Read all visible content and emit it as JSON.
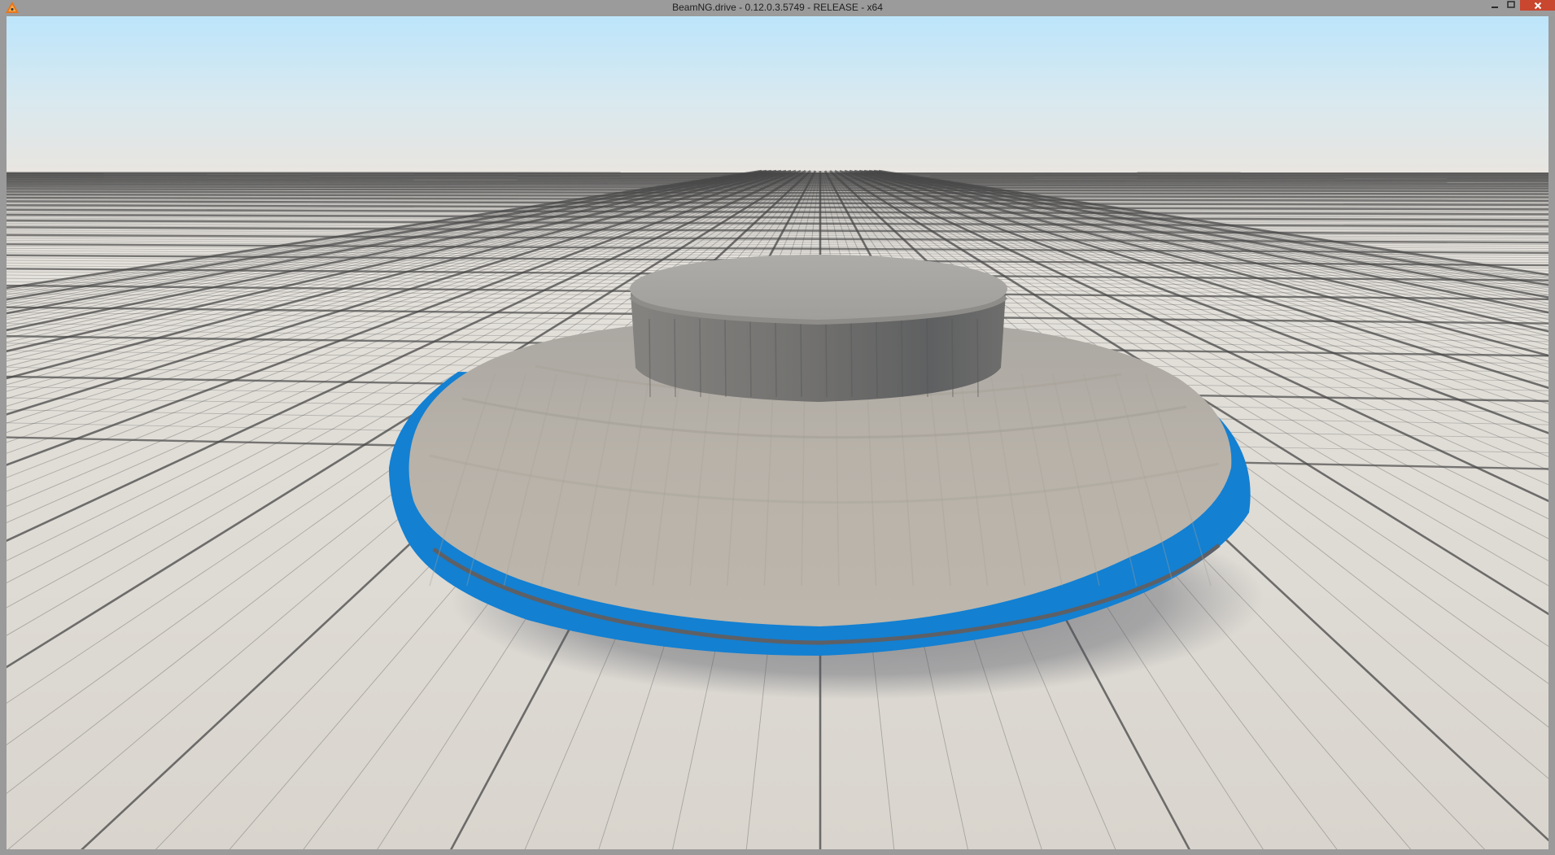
{
  "window": {
    "title": "BeamNG.drive - 0.12.0.3.5749 - RELEASE - x64",
    "app_icon": "beamng-logo-icon",
    "controls": {
      "minimize_icon": "minimize-icon",
      "maximize_icon": "maximize-icon",
      "close_icon": "close-icon"
    }
  },
  "scene": {
    "sky_top_color": "#bfe6fb",
    "horizon_color": "#e7e4df",
    "ground_color": "#ddd9d2",
    "grid_line_color": "#4a4a4a",
    "object_body_color": "#b9b3aa",
    "object_top_color": "#a8a6a2",
    "object_side_color": "#767573",
    "object_rim_color": "#1380d2"
  }
}
